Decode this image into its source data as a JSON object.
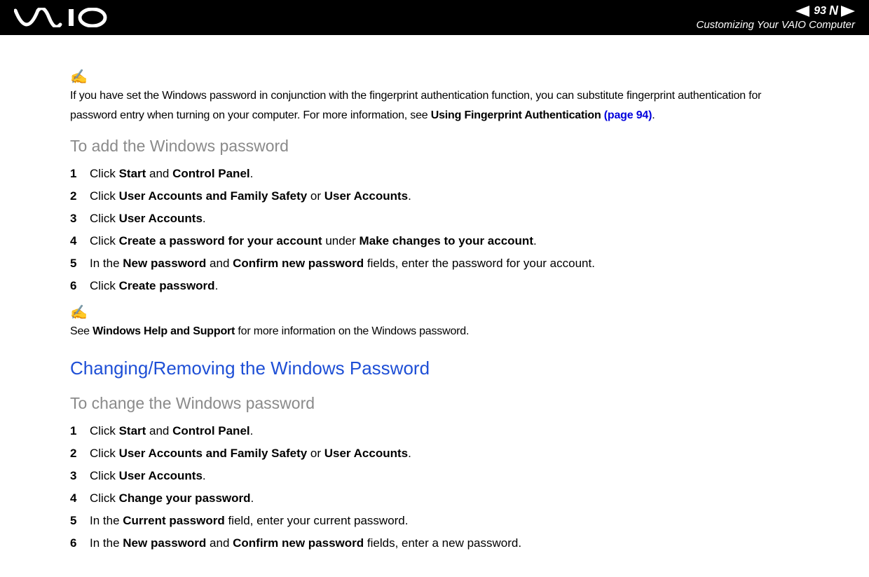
{
  "header": {
    "page_number": "93",
    "n_label": "N",
    "subtitle": "Customizing Your VAIO Computer"
  },
  "note1": {
    "icon": "✍",
    "text_before": "If you have set the Windows password in conjunction with the fingerprint authentication function, you can substitute fingerprint authentication for password entry when turning on your computer. For more information, see ",
    "bold1": "Using Fingerprint Authentication ",
    "link": "(page 94)",
    "text_after": "."
  },
  "heading_add": "To add the Windows password",
  "steps_add": {
    "s1_a": "Click ",
    "s1_b1": "Start",
    "s1_c": " and ",
    "s1_b2": "Control Panel",
    "s1_d": ".",
    "s2_a": "Click ",
    "s2_b1": "User Accounts and Family Safety",
    "s2_c": " or ",
    "s2_b2": "User Accounts",
    "s2_d": ".",
    "s3_a": "Click ",
    "s3_b1": "User Accounts",
    "s3_d": ".",
    "s4_a": "Click ",
    "s4_b1": "Create a password for your account",
    "s4_c": " under ",
    "s4_b2": "Make changes to your account",
    "s4_d": ".",
    "s5_a": "In the ",
    "s5_b1": "New password",
    "s5_c": " and ",
    "s5_b2": "Confirm new password",
    "s5_d": " fields, enter the password for your account.",
    "s6_a": "Click ",
    "s6_b1": "Create password",
    "s6_d": "."
  },
  "note2": {
    "icon": "✍",
    "text_before": "See ",
    "bold1": "Windows Help and Support",
    "text_after": " for more information on the Windows password."
  },
  "heading_change_remove": "Changing/Removing the Windows Password",
  "heading_change": "To change the Windows password",
  "steps_change": {
    "s1_a": "Click ",
    "s1_b1": "Start",
    "s1_c": " and ",
    "s1_b2": "Control Panel",
    "s1_d": ".",
    "s2_a": "Click ",
    "s2_b1": "User Accounts and Family Safety",
    "s2_c": " or ",
    "s2_b2": "User Accounts",
    "s2_d": ".",
    "s3_a": "Click ",
    "s3_b1": "User Accounts",
    "s3_d": ".",
    "s4_a": "Click ",
    "s4_b1": "Change your password",
    "s4_d": ".",
    "s5_a": "In the ",
    "s5_b1": "Current password",
    "s5_d": " field, enter your current password.",
    "s6_a": "In the ",
    "s6_b1": "New password",
    "s6_c": " and ",
    "s6_b2": "Confirm new password",
    "s6_d": " fields, enter a new password."
  }
}
